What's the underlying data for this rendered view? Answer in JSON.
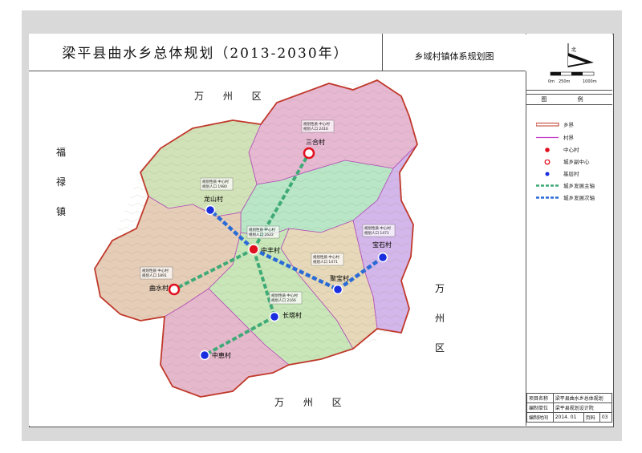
{
  "header": {
    "title": "梁平县曲水乡总体规划（2013-2030年）",
    "subtitle": "乡域村镇体系规划图"
  },
  "north_arrow": {
    "north_symbol": "北",
    "scale_labels": [
      "0m",
      "250m",
      "1000m"
    ]
  },
  "legend": {
    "title": "图 例",
    "items": [
      {
        "label": "乡界",
        "symbol": "township-boundary",
        "color": "#c0392b"
      },
      {
        "label": "村界",
        "symbol": "village-boundary",
        "color": "#c23fc4"
      },
      {
        "label": "中心村",
        "symbol": "central-village",
        "color": "#e0101e"
      },
      {
        "label": "城乡副中心",
        "symbol": "sub-center",
        "color": "#e0101e"
      },
      {
        "label": "基层村",
        "symbol": "grassroots-village",
        "color": "#1a2ee0"
      },
      {
        "label": "城乡发展主轴",
        "symbol": "main-axis",
        "color": "#3faa77"
      },
      {
        "label": "城乡发展次轴",
        "symbol": "secondary-axis",
        "color": "#2a6bd6"
      }
    ]
  },
  "neighbors": {
    "north": "万 州 区",
    "west": [
      "福",
      "禄",
      "镇"
    ],
    "east": [
      "万",
      "州",
      "区"
    ],
    "south": "万 州 区"
  },
  "villages": [
    {
      "name": "三合村",
      "type": "sub-center",
      "info": [
        "规划性质  中心村",
        "规划人口  2416"
      ]
    },
    {
      "name": "龙山村",
      "type": "grassroots",
      "info": [
        "规划性质  中心村",
        "规划人口  1980"
      ]
    },
    {
      "name": "中丰村",
      "type": "center",
      "info": [
        "规划性质  中心村",
        "规划人口  2622"
      ]
    },
    {
      "name": "宝石村",
      "type": "grassroots",
      "info": [
        "规划性质  中心村",
        "规划人口  1471"
      ]
    },
    {
      "name": "聚宝村",
      "type": "grassroots",
      "info": [
        "规划性质  中心村",
        "规划人口  1471"
      ]
    },
    {
      "name": "曲水村",
      "type": "sub-center",
      "info": [
        "规划性质  中心村",
        "规划人口  1891"
      ]
    },
    {
      "name": "长塔村",
      "type": "grassroots",
      "info": [
        "规划性质  中心村",
        "规划人口  2166"
      ]
    },
    {
      "name": "中恵村",
      "type": "grassroots",
      "info": []
    }
  ],
  "title_block": {
    "project_label": "项目名称",
    "project_value": "梁平县曲水乡总体规划",
    "unit_label": "编制单位",
    "unit_value": "梁平县规划设计院",
    "time_label": "编制时间",
    "time_value": "2014. 01",
    "page_label": "页码",
    "page_value": "03"
  }
}
